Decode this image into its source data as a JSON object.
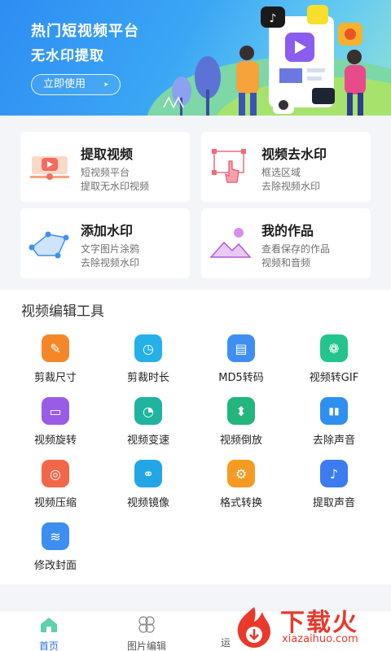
{
  "banner": {
    "title": "热门短视频平台",
    "subtitle": "无水印提取",
    "button_label": "立即使用",
    "button_arrow": "▸"
  },
  "cards": [
    {
      "title": "提取视频",
      "desc1": "短视频平台",
      "desc2": "提取无水印视频",
      "icon": "video-extract-icon"
    },
    {
      "title": "视频去水印",
      "desc1": "框选区域",
      "desc2": "去除视频水印",
      "icon": "hand-select-icon"
    },
    {
      "title": "添加水印",
      "desc1": "文字图片涂鸦",
      "desc2": "去除视频水印",
      "icon": "pen-draw-icon"
    },
    {
      "title": "我的作品",
      "desc1": "查看保存的作品",
      "desc2": "视频和音频",
      "icon": "mountain-image-icon"
    }
  ],
  "tools": {
    "title": "视频编辑工具",
    "items": [
      {
        "label": "剪裁尺寸",
        "icon": "ruler-icon",
        "glyph": "✎",
        "color": "#f5872b"
      },
      {
        "label": "剪裁时长",
        "icon": "clock-icon",
        "glyph": "◷",
        "color": "#26b0e8"
      },
      {
        "label": "MD5转码",
        "icon": "document-icon",
        "glyph": "▤",
        "color": "#3f8ff2"
      },
      {
        "label": "视频转GIF",
        "icon": "palette-icon",
        "glyph": "❁",
        "color": "#23c48e"
      },
      {
        "label": "视频旋转",
        "icon": "screen-icon",
        "glyph": "▭",
        "color": "#9a5ce6"
      },
      {
        "label": "视频变速",
        "icon": "speedometer-icon",
        "glyph": "◔",
        "color": "#1fb3a0"
      },
      {
        "label": "视频倒放",
        "icon": "stamp-icon",
        "glyph": "⬍",
        "color": "#22b57c"
      },
      {
        "label": "去除声音",
        "icon": "waveform-icon",
        "glyph": "▮▮",
        "color": "#2f8ff0"
      },
      {
        "label": "视频压缩",
        "icon": "compress-icon",
        "glyph": "◎",
        "color": "#f2674a"
      },
      {
        "label": "视频镜像",
        "icon": "mirror-icon",
        "glyph": "⚭",
        "color": "#22a6e6"
      },
      {
        "label": "格式转换",
        "icon": "gear-icon",
        "glyph": "⚙",
        "color": "#f59a23"
      },
      {
        "label": "提取声音",
        "icon": "music-note-icon",
        "glyph": "♪",
        "color": "#3b7cf0"
      },
      {
        "label": "修改封面",
        "icon": "cover-icon",
        "glyph": "≋",
        "color": "#3e8ef0"
      }
    ]
  },
  "nav": {
    "items": [
      {
        "label": "首页",
        "icon": "home-icon",
        "glyph": "⌂",
        "active": true
      },
      {
        "label": "图片编辑",
        "icon": "flower-icon",
        "glyph": "✿",
        "active": false
      },
      {
        "label": "运",
        "icon": "partial-icon",
        "glyph": "",
        "active": false
      }
    ]
  },
  "watermark": {
    "text": "下载火",
    "url": "xiazaihuo.com"
  },
  "colors": {
    "accent": "#2a6ff0",
    "banner_start": "#2e8df3",
    "banner_end": "#8fe0d8",
    "watermark_red": "#e8392a"
  }
}
